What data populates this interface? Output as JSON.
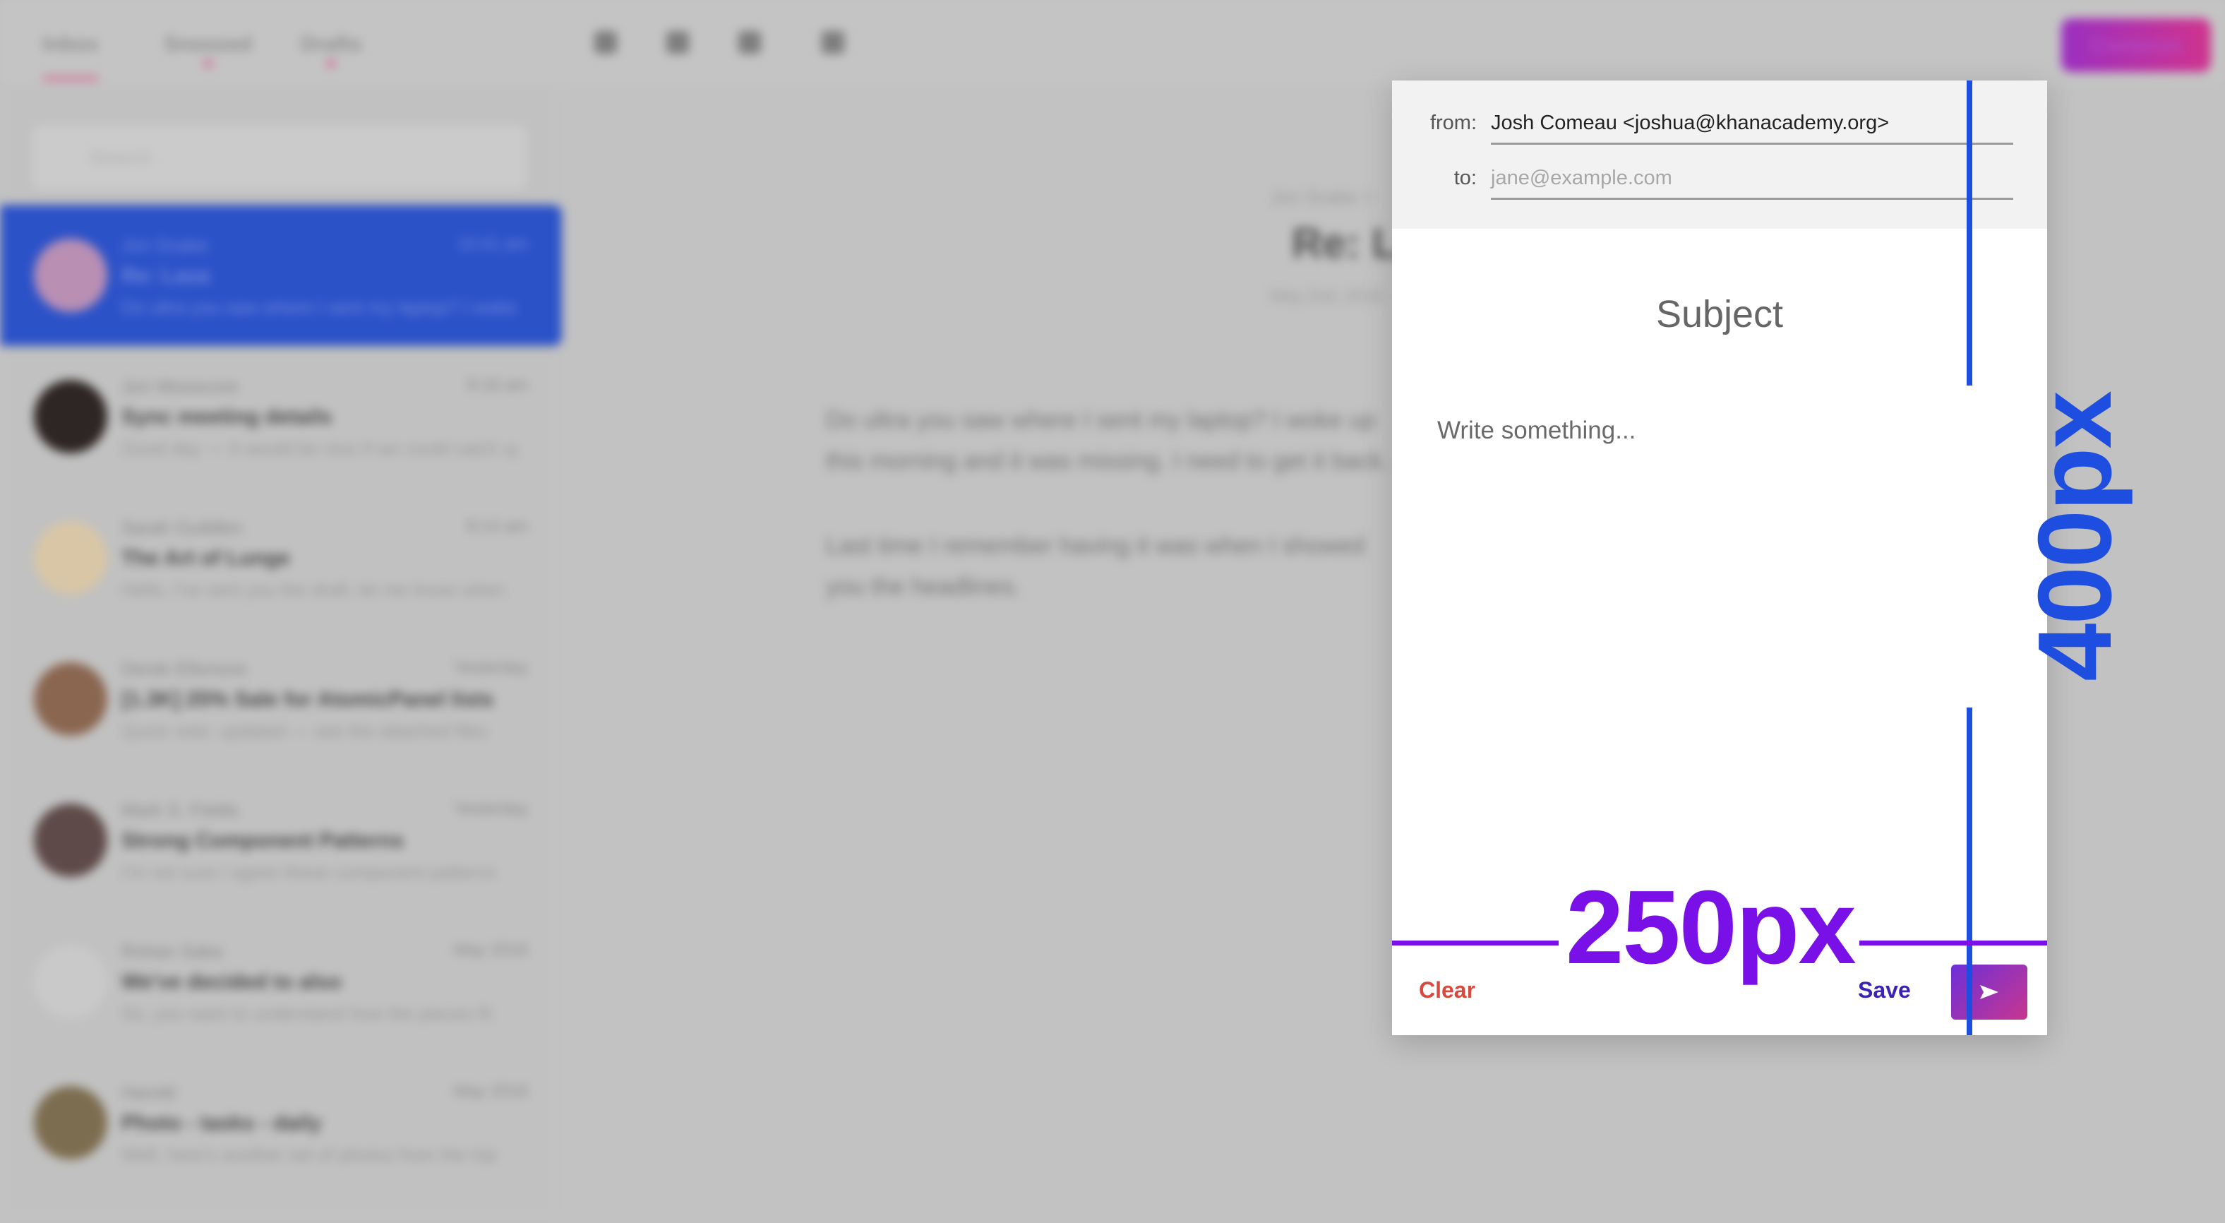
{
  "nav": {
    "tabs": [
      "Inbox",
      "Snoozed",
      "Drafts"
    ],
    "compose_label": "Compose"
  },
  "search": {
    "placeholder": "Search"
  },
  "mail_list": [
    {
      "sender": "Jon Snake",
      "time": "10:41 am",
      "subject": "Re: Lasa",
      "preview": "Do ultra you saw where I sent my laptop? I woke up"
    },
    {
      "sender": "Jon Wooscore",
      "time": "9:18 am",
      "subject": "Sync meeting details",
      "preview": "Good day — It would be nice if we could catch up"
    },
    {
      "sender": "Sarah Guildlen",
      "time": "8:14 am",
      "subject": "The Art of Lunge",
      "preview": "Hello, I've sent you the draft, let me know when"
    },
    {
      "sender": "Derek Ellsmore",
      "time": "Yesterday",
      "subject": "[1.3K] 25% Sale for AtomicPanel lists",
      "preview": "Quick note: updated — see the attached files"
    },
    {
      "sender": "Mark S. Fields",
      "time": "Yesterday",
      "subject": "Strong Component Patterns",
      "preview": "I'm not sure I agree these component patterns"
    },
    {
      "sender": "Rohan Saka",
      "time": "May 2016",
      "subject": "We've decided to also",
      "preview": "So, you want to understand how the pieces fit"
    },
    {
      "sender": "Harold",
      "time": "May 2016",
      "subject": "Photo - tasks - daily",
      "preview": "Well, here's another set of photos from the trip"
    }
  ],
  "reader": {
    "crumb": "Jon Snake >",
    "title": "Re: La",
    "date": "May 2nd, 2016",
    "paragraphs": [
      "Do ultra you saw where I sent my laptop? I woke up this morning and it was missing. I need to get it back.",
      "Last time I remember having it was when I showed you the headlines."
    ]
  },
  "compose": {
    "from_label": "from:",
    "from_value": "Josh Comeau <joshua@khanacademy.org>",
    "to_label": "to:",
    "to_placeholder": "jane@example.com",
    "subject_placeholder": "Subject",
    "body_placeholder": "Write something...",
    "clear_label": "Clear",
    "save_label": "Save",
    "send_icon": "send-arrow-icon"
  },
  "annotations": {
    "width_label": "250px",
    "height_label": "400px",
    "width_color": "#7a10e8",
    "height_color": "#1e4ee0"
  }
}
